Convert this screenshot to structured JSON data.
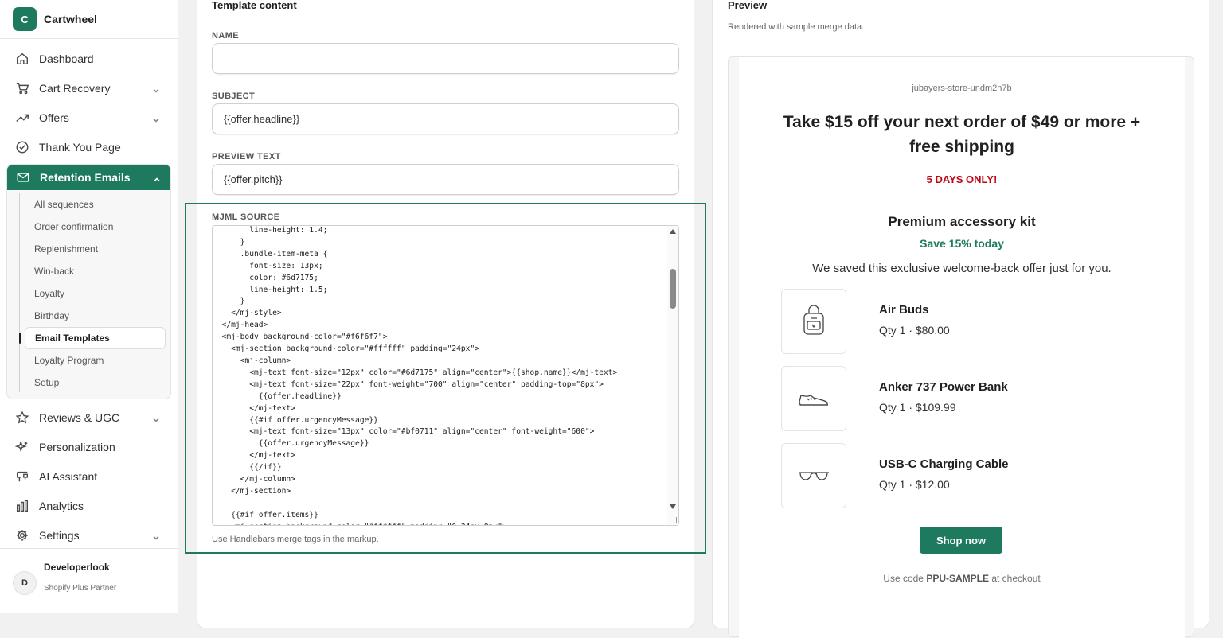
{
  "brand": {
    "logo_letter": "C",
    "name": "Cartwheel",
    "accent": "#1e7a5e"
  },
  "nav": {
    "dashboard": "Dashboard",
    "cart_recovery": "Cart Recovery",
    "offers": "Offers",
    "thank_you": "Thank You Page",
    "retention_emails": "Retention Emails",
    "sub_items": [
      "All sequences",
      "Order confirmation",
      "Replenishment",
      "Win-back",
      "Loyalty",
      "Birthday",
      "Email Templates",
      "Loyalty Program",
      "Setup"
    ],
    "reviews": "Reviews & UGC",
    "personalization": "Personalization",
    "ai_assistant": "AI Assistant",
    "analytics": "Analytics",
    "settings": "Settings"
  },
  "user": {
    "initial": "D",
    "name": "Developerlook",
    "role": "Shopify Plus Partner"
  },
  "editor": {
    "title": "Template content",
    "name_label": "NAME",
    "name_value": "",
    "subject_label": "SUBJECT",
    "subject_value": "{{offer.headline}}",
    "preview_label": "PREVIEW TEXT",
    "preview_value": "{{offer.pitch}}",
    "mjml_label": "MJML SOURCE",
    "mjml_source": "        line-height: 1.4;\n      }\n      .bundle-item-meta {\n        font-size: 13px;\n        color: #6d7175;\n        line-height: 1.5;\n      }\n    </mj-style>\n  </mj-head>\n  <mj-body background-color=\"#f6f6f7\">\n    <mj-section background-color=\"#ffffff\" padding=\"24px\">\n      <mj-column>\n        <mj-text font-size=\"12px\" color=\"#6d7175\" align=\"center\">{{shop.name}}</mj-text>\n        <mj-text font-size=\"22px\" font-weight=\"700\" align=\"center\" padding-top=\"8px\">\n          {{offer.headline}}\n        </mj-text>\n        {{#if offer.urgencyMessage}}\n        <mj-text font-size=\"13px\" color=\"#bf0711\" align=\"center\" font-weight=\"600\">\n          {{offer.urgencyMessage}}\n        </mj-text>\n        {{/if}}\n      </mj-column>\n    </mj-section>\n\n    {{#if offer.items}}\n    <mj-section background-color=\"#ffffff\" padding=\"0 24px 8px\">",
    "help": "Use Handlebars merge tags in the markup."
  },
  "preview": {
    "title": "Preview",
    "subtitle": "Rendered with sample merge data.",
    "shop_name": "jubayers-store-undm2n7b",
    "headline": "Take $15 off your next order of $49 or more + free shipping",
    "urgency": "5 DAYS ONLY!",
    "kit_title": "Premium accessory kit",
    "kit_save": "Save 15% today",
    "pitch": "We saved this exclusive welcome-back offer just for you.",
    "items": [
      {
        "name": "Air Buds",
        "meta": "Qty 1 · $80.00",
        "icon": "backpack-icon"
      },
      {
        "name": "Anker 737 Power Bank",
        "meta": "Qty 1 · $109.99",
        "icon": "sneaker-icon"
      },
      {
        "name": "USB-C Charging Cable",
        "meta": "Qty 1 · $12.00",
        "icon": "glasses-icon"
      }
    ],
    "cta": "Shop now",
    "code_prefix": "Use code ",
    "code": "PPU-SAMPLE",
    "code_suffix": " at checkout"
  }
}
